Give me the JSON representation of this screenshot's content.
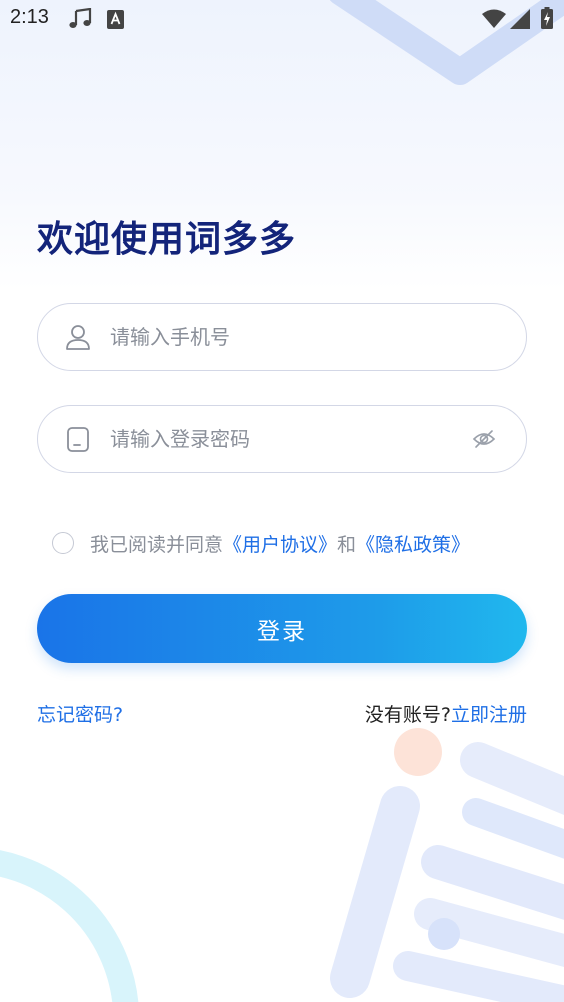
{
  "status_bar": {
    "time": "2:13",
    "icons": [
      "music-note-icon",
      "keyboard-a-icon",
      "wifi-icon",
      "cell-signal-icon",
      "battery-charging-icon"
    ]
  },
  "welcome": {
    "title": "欢迎使用词多多"
  },
  "phone": {
    "placeholder": "请输入手机号",
    "value": "",
    "icon": "user-icon"
  },
  "password": {
    "placeholder": "请输入登录密码",
    "value": "",
    "icon": "phone-lock-icon",
    "toggle_icon": "eye-off-icon"
  },
  "agreement": {
    "checked": false,
    "prefix": "我已阅读并同意",
    "user_agreement": "《用户协议》",
    "conjunction": "和",
    "privacy_policy": "《隐私政策》"
  },
  "login": {
    "label": "登录"
  },
  "links": {
    "forgot_password": "忘记密码?",
    "no_account": "没有账号?",
    "register": "立即注册"
  },
  "colors": {
    "title": "#13247a",
    "link": "#1f6fe6",
    "button_start": "#1a74e8",
    "button_end": "#20b8ee",
    "placeholder": "#8a8f99",
    "border": "#d3d7e6"
  }
}
